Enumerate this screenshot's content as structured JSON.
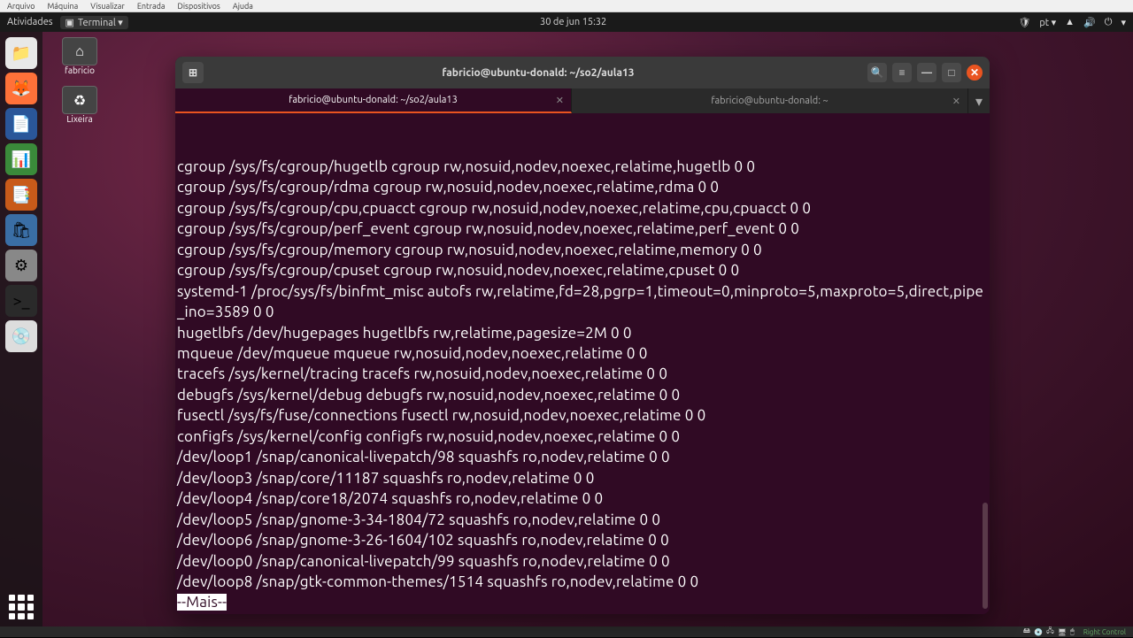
{
  "vm_menu": {
    "items": [
      "Arquivo",
      "Máquina",
      "Visualizar",
      "Entrada",
      "Dispositivos",
      "Ajuda"
    ]
  },
  "vm_status": {
    "right_ctrl": "Right Control"
  },
  "topbar": {
    "activities": "Atividades",
    "app_menu": "Terminal ▾",
    "datetime": "30 de jun  15:32",
    "lang": "pt ▾"
  },
  "desktop_icons": [
    {
      "label": "fabricio",
      "glyph": "⌂"
    },
    {
      "label": "Lixeira",
      "glyph": "♻"
    }
  ],
  "terminal": {
    "title": "fabricio@ubuntu-donald: ~/so2/aula13",
    "tabs": [
      {
        "label": "fabricio@ubuntu-donald: ~/so2/aula13",
        "active": true
      },
      {
        "label": "fabricio@ubuntu-donald: ~",
        "active": false
      }
    ],
    "lines": [
      "cgroup /sys/fs/cgroup/hugetlb cgroup rw,nosuid,nodev,noexec,relatime,hugetlb 0 0",
      "cgroup /sys/fs/cgroup/rdma cgroup rw,nosuid,nodev,noexec,relatime,rdma 0 0",
      "cgroup /sys/fs/cgroup/cpu,cpuacct cgroup rw,nosuid,nodev,noexec,relatime,cpu,cpuacct 0 0",
      "cgroup /sys/fs/cgroup/perf_event cgroup rw,nosuid,nodev,noexec,relatime,perf_event 0 0",
      "cgroup /sys/fs/cgroup/memory cgroup rw,nosuid,nodev,noexec,relatime,memory 0 0",
      "cgroup /sys/fs/cgroup/cpuset cgroup rw,nosuid,nodev,noexec,relatime,cpuset 0 0",
      "systemd-1 /proc/sys/fs/binfmt_misc autofs rw,relatime,fd=28,pgrp=1,timeout=0,minproto=5,maxproto=5,direct,pipe_ino=3589 0 0",
      "hugetlbfs /dev/hugepages hugetlbfs rw,relatime,pagesize=2M 0 0",
      "mqueue /dev/mqueue mqueue rw,nosuid,nodev,noexec,relatime 0 0",
      "tracefs /sys/kernel/tracing tracefs rw,nosuid,nodev,noexec,relatime 0 0",
      "debugfs /sys/kernel/debug debugfs rw,nosuid,nodev,noexec,relatime 0 0",
      "fusectl /sys/fs/fuse/connections fusectl rw,nosuid,nodev,noexec,relatime 0 0",
      "configfs /sys/kernel/config configfs rw,nosuid,nodev,noexec,relatime 0 0",
      "/dev/loop1 /snap/canonical-livepatch/98 squashfs ro,nodev,relatime 0 0",
      "/dev/loop3 /snap/core/11187 squashfs ro,nodev,relatime 0 0",
      "/dev/loop4 /snap/core18/2074 squashfs ro,nodev,relatime 0 0",
      "/dev/loop5 /snap/gnome-3-34-1804/72 squashfs ro,nodev,relatime 0 0",
      "/dev/loop6 /snap/gnome-3-26-1604/102 squashfs ro,nodev,relatime 0 0",
      "/dev/loop0 /snap/canonical-livepatch/99 squashfs ro,nodev,relatime 0 0",
      "/dev/loop8 /snap/gtk-common-themes/1514 squashfs ro,nodev,relatime 0 0"
    ],
    "more_prompt": "--Mais--"
  },
  "dock_items": [
    {
      "name": "files",
      "bg": "#e8e8e8",
      "glyph": "📁"
    },
    {
      "name": "firefox",
      "bg": "#ff7139",
      "glyph": "🦊"
    },
    {
      "name": "word",
      "bg": "#2a5699",
      "glyph": "📄"
    },
    {
      "name": "calc",
      "bg": "#3a8a3a",
      "glyph": "📊"
    },
    {
      "name": "impress",
      "bg": "#c85a1a",
      "glyph": "📑"
    },
    {
      "name": "software",
      "bg": "#3a6ea5",
      "glyph": "🛍"
    },
    {
      "name": "settings",
      "bg": "#888",
      "glyph": "⚙"
    },
    {
      "name": "terminal",
      "bg": "#2a2a2a",
      "glyph": ">_"
    },
    {
      "name": "disc",
      "bg": "#ddd",
      "glyph": "💿"
    }
  ]
}
